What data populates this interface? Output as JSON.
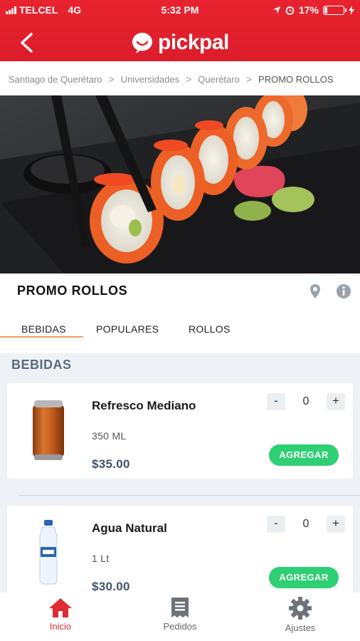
{
  "status_bar": {
    "carrier": "TELCEL",
    "network": "4G",
    "time": "5:32 PM",
    "battery": "17%",
    "battery_level": 0.17
  },
  "header": {
    "logo_text": "pickpal",
    "brand_color": "#e8232f"
  },
  "breadcrumb": {
    "items": [
      "Santiago de Querétaro",
      "Universidades",
      "Querétaro",
      "PROMO  ROLLOS"
    ],
    "separator": ">"
  },
  "restaurant": {
    "title": "PROMO  ROLLOS"
  },
  "tabs": [
    "BEBIDAS",
    "POPULARES",
    "ROLLOS"
  ],
  "tabs_active": "BEBIDAS",
  "section": {
    "title": "BEBIDAS"
  },
  "products": [
    {
      "name": "Refresco Mediano",
      "size": "350 ML",
      "price": "$35.00",
      "quantity": "0",
      "minus": "-",
      "plus": "+",
      "add_label": "AGREGAR",
      "image": "soda-can-icon"
    },
    {
      "name": "Agua Natural",
      "size": "1 Lt",
      "price": "$30.00",
      "quantity": "0",
      "minus": "-",
      "plus": "+",
      "add_label": "AGREGAR",
      "image": "water-bottle-icon"
    }
  ],
  "bottom_nav": [
    {
      "label": "Inicio",
      "icon": "home-icon",
      "active": true
    },
    {
      "label": "Pedidos",
      "icon": "receipt-icon",
      "active": false
    },
    {
      "label": "Ajustes",
      "icon": "gear-icon",
      "active": false
    }
  ],
  "colors": {
    "accent_red": "#e8232f",
    "add_button_green": "#2fcf74",
    "tab_underline": "#f29c6b",
    "price_text": "#41546a"
  }
}
